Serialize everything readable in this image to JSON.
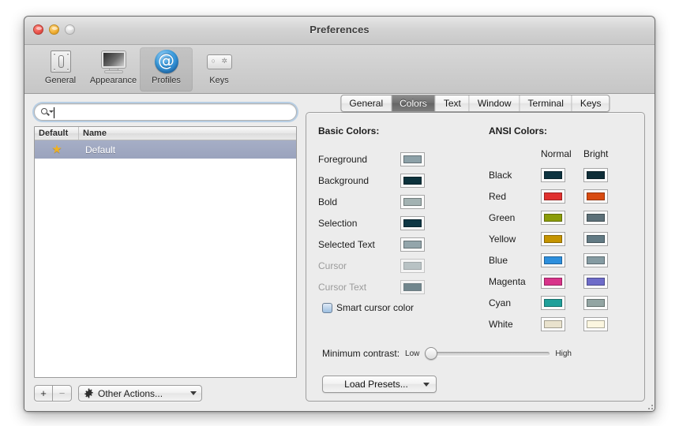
{
  "window": {
    "title": "Preferences",
    "traffic_lights": [
      "close",
      "minimize",
      "zoom"
    ]
  },
  "toolbar": {
    "items": [
      {
        "label": "General",
        "icon": "general-icon",
        "selected": false
      },
      {
        "label": "Appearance",
        "icon": "appearance-icon",
        "selected": false
      },
      {
        "label": "Profiles",
        "icon": "profiles-icon",
        "selected": true
      },
      {
        "label": "Keys",
        "icon": "keys-icon",
        "selected": false
      }
    ]
  },
  "sidebar": {
    "search": {
      "value": "",
      "placeholder": ""
    },
    "table": {
      "columns": [
        "Default",
        "Name"
      ],
      "rows": [
        {
          "default_star": "★",
          "name": "Default",
          "selected": true
        }
      ]
    },
    "bottom_bar": {
      "add_label": "+",
      "remove_label": "−",
      "other_actions_label": "Other Actions..."
    }
  },
  "tabs": [
    {
      "label": "General",
      "active": false
    },
    {
      "label": "Colors",
      "active": true
    },
    {
      "label": "Text",
      "active": false
    },
    {
      "label": "Window",
      "active": false
    },
    {
      "label": "Terminal",
      "active": false
    },
    {
      "label": "Keys",
      "active": false
    }
  ],
  "colors_panel": {
    "basic_title": "Basic Colors:",
    "basic": [
      {
        "label": "Foreground",
        "color": "#8da1a8",
        "disabled": false
      },
      {
        "label": "Background",
        "color": "#0c323c",
        "disabled": false
      },
      {
        "label": "Bold",
        "color": "#a3b2b2",
        "disabled": false
      },
      {
        "label": "Selection",
        "color": "#0e3744",
        "disabled": false
      },
      {
        "label": "Selected Text",
        "color": "#93a5ab",
        "disabled": false
      },
      {
        "label": "Cursor",
        "color": "#8ea0a5",
        "disabled": true
      },
      {
        "label": "Cursor Text",
        "color": "#0d3340",
        "disabled": true
      }
    ],
    "ansi_title": "ANSI Colors:",
    "ansi_headers": [
      "Normal",
      "Bright"
    ],
    "ansi": [
      {
        "label": "Black",
        "normal": "#0d3340",
        "bright": "#0f2e38"
      },
      {
        "label": "Red",
        "normal": "#e0302e",
        "bright": "#d84b11"
      },
      {
        "label": "Green",
        "normal": "#8b9c09",
        "bright": "#5c7078"
      },
      {
        "label": "Yellow",
        "normal": "#c59400",
        "bright": "#627a84"
      },
      {
        "label": "Blue",
        "normal": "#2d8fdd",
        "bright": "#859ba2"
      },
      {
        "label": "Magenta",
        "normal": "#d8348a",
        "bright": "#6e6cc9"
      },
      {
        "label": "Cyan",
        "normal": "#20a09a",
        "bright": "#93a5a3"
      },
      {
        "label": "White",
        "normal": "#e9e2cd",
        "bright": "#fbf6e0"
      }
    ],
    "smart_cursor": {
      "label": "Smart cursor color",
      "checked": true
    },
    "contrast": {
      "title": "Minimum contrast:",
      "low_label": "Low",
      "high_label": "High",
      "value_percent": 0
    },
    "load_presets_label": "Load Presets..."
  }
}
